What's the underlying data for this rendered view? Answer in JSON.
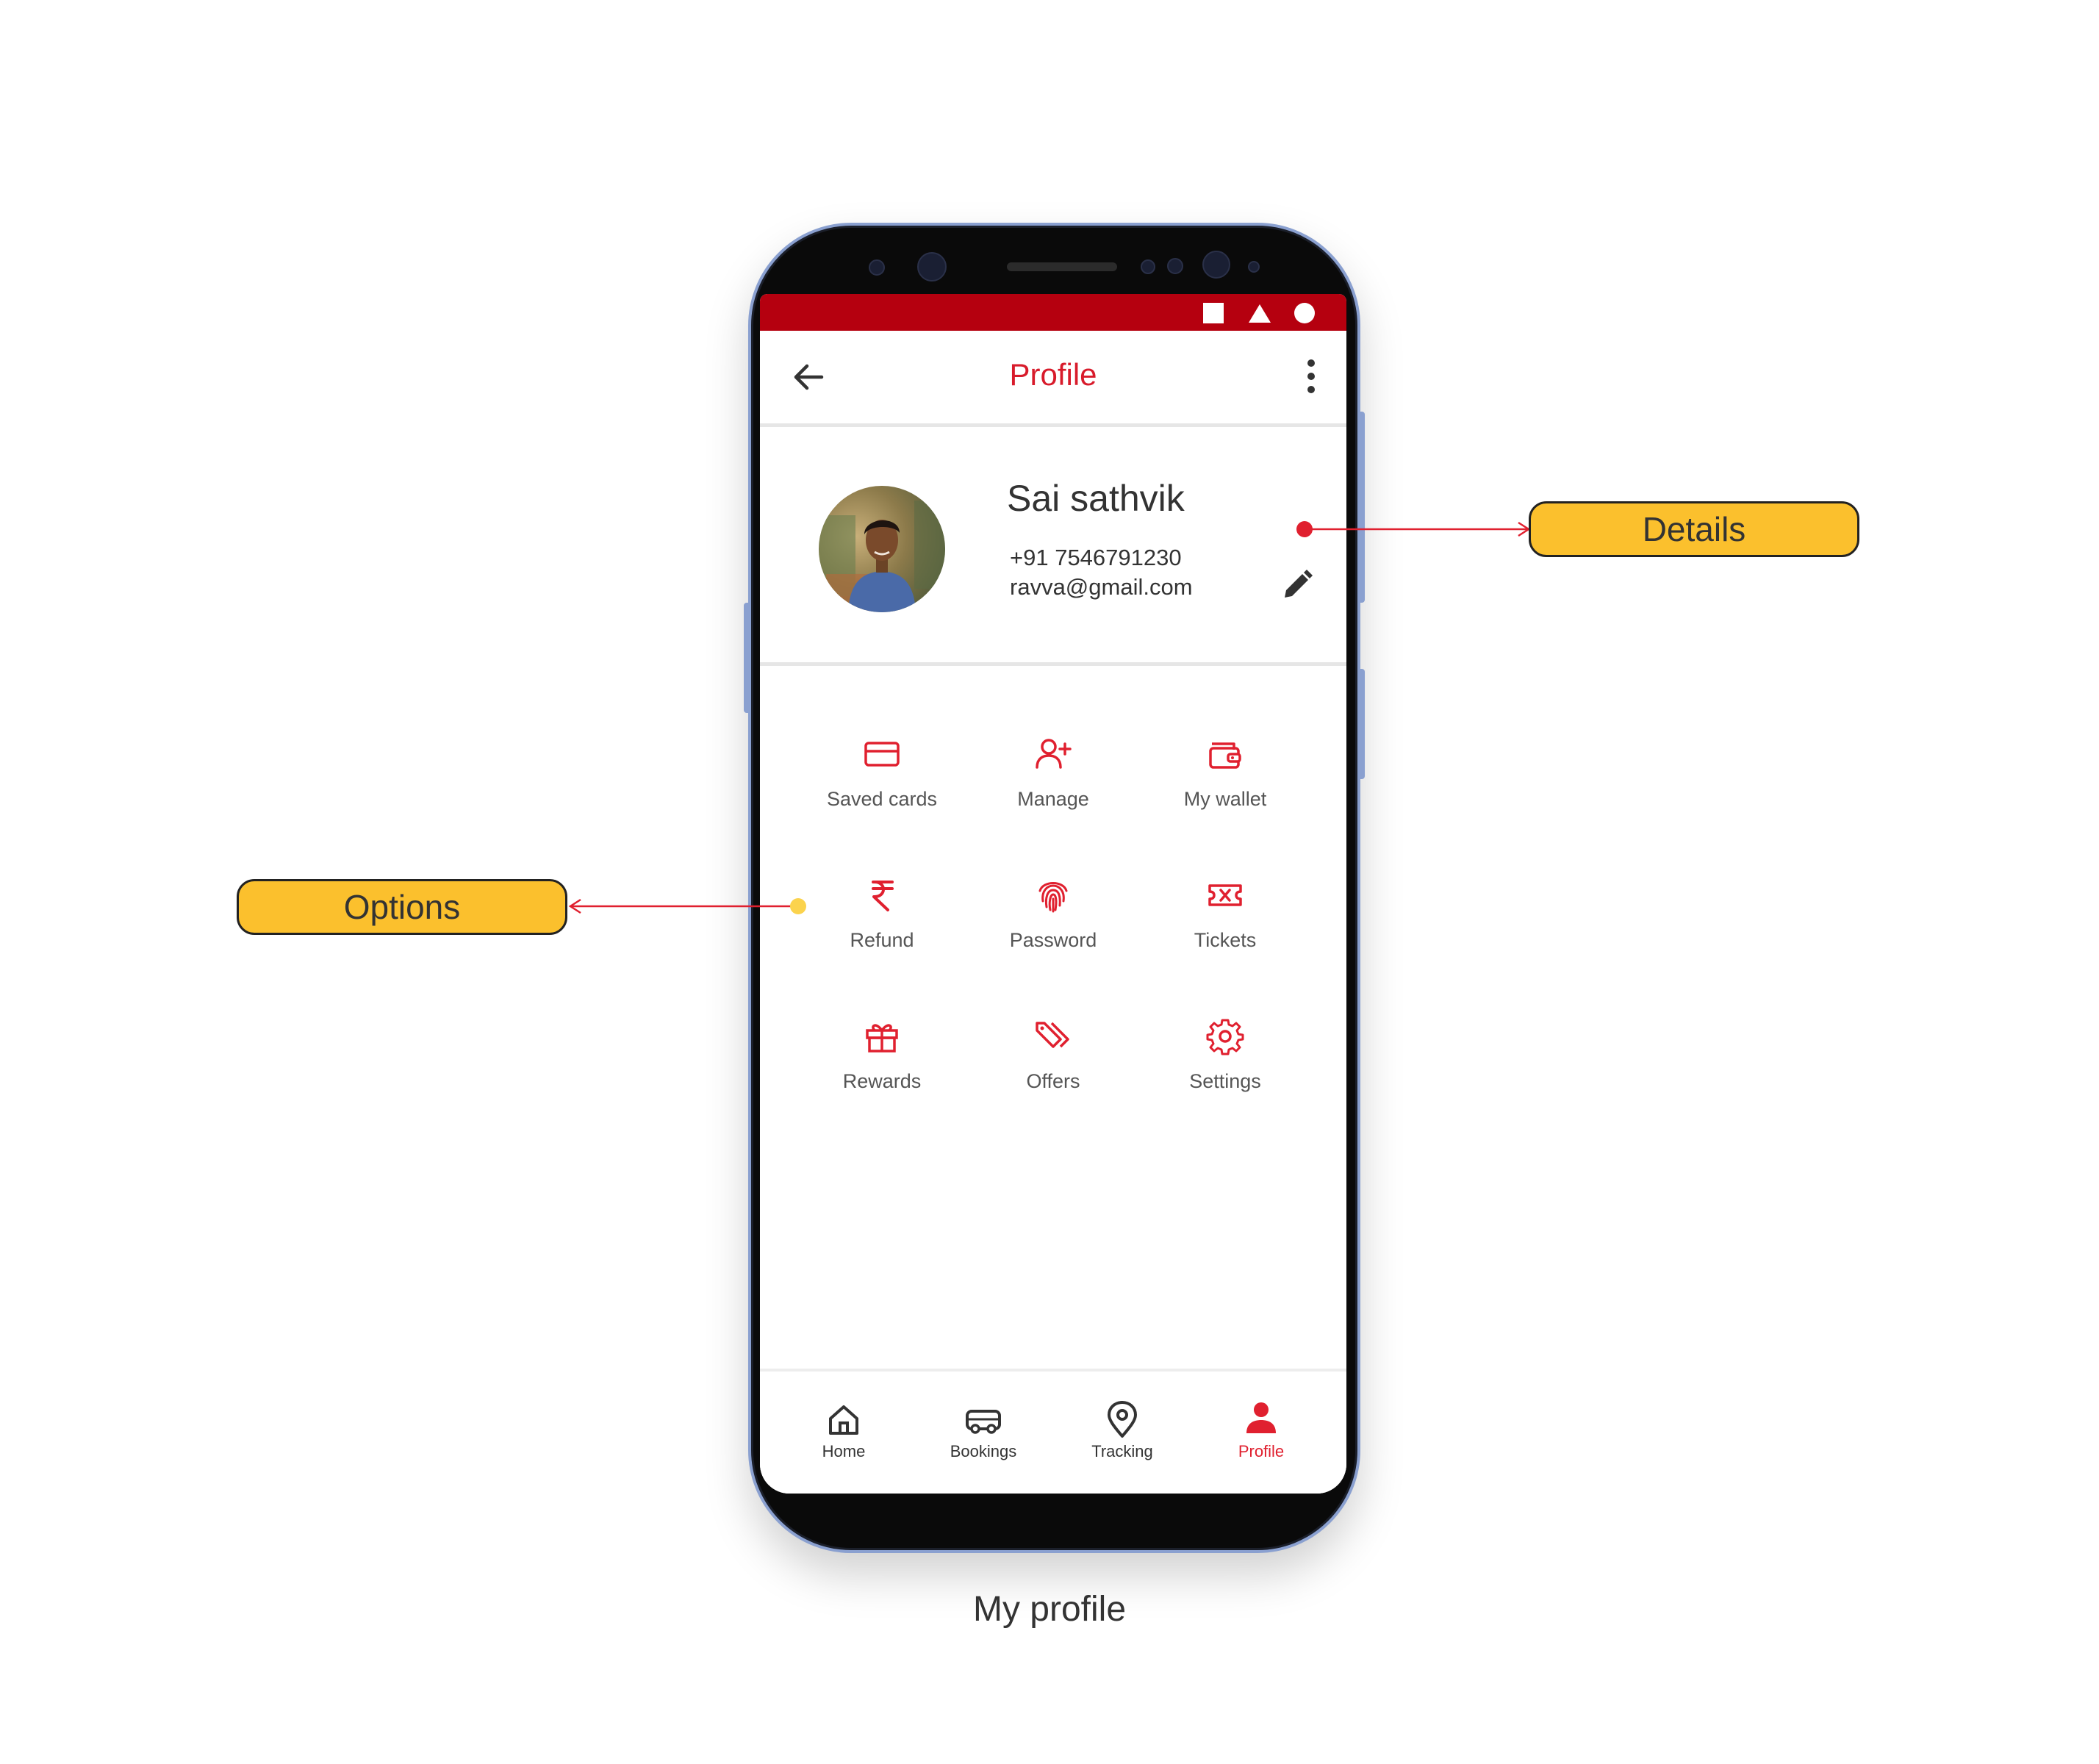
{
  "app": {
    "title": "Profile",
    "accent_color": "#d81b2b",
    "statusbar_color": "#b5000f"
  },
  "statusbar": {
    "icons": [
      "square-icon",
      "triangle-icon",
      "circle-icon"
    ]
  },
  "header": {
    "back_icon": "arrow-left-icon",
    "menu_icon": "more-vertical-icon"
  },
  "profile": {
    "name": "Sai sathvik",
    "phone": "+91 7546791230",
    "email": "ravva@gmail.com",
    "edit_icon": "pencil-icon"
  },
  "options": [
    {
      "label": "Saved cards",
      "icon": "credit-card-icon"
    },
    {
      "label": "Manage",
      "icon": "user-plus-icon"
    },
    {
      "label": "My wallet",
      "icon": "wallet-icon"
    },
    {
      "label": "Refund",
      "icon": "rupee-icon"
    },
    {
      "label": "Password",
      "icon": "fingerprint-icon"
    },
    {
      "label": "Tickets",
      "icon": "ticket-icon"
    },
    {
      "label": "Rewards",
      "icon": "gift-icon"
    },
    {
      "label": "Offers",
      "icon": "tag-icon"
    },
    {
      "label": "Settings",
      "icon": "gear-icon"
    }
  ],
  "bottom_nav": [
    {
      "label": "Home",
      "icon": "home-icon",
      "active": false
    },
    {
      "label": "Bookings",
      "icon": "bus-icon",
      "active": false
    },
    {
      "label": "Tracking",
      "icon": "location-pin-icon",
      "active": false
    },
    {
      "label": "Profile",
      "icon": "person-icon",
      "active": true
    }
  ],
  "annotations": {
    "details": "Details",
    "options": "Options",
    "details_dot_color": "#e0202f",
    "options_dot_color": "#fbd34d",
    "callout_color": "#fbc02d"
  },
  "caption": "My profile"
}
